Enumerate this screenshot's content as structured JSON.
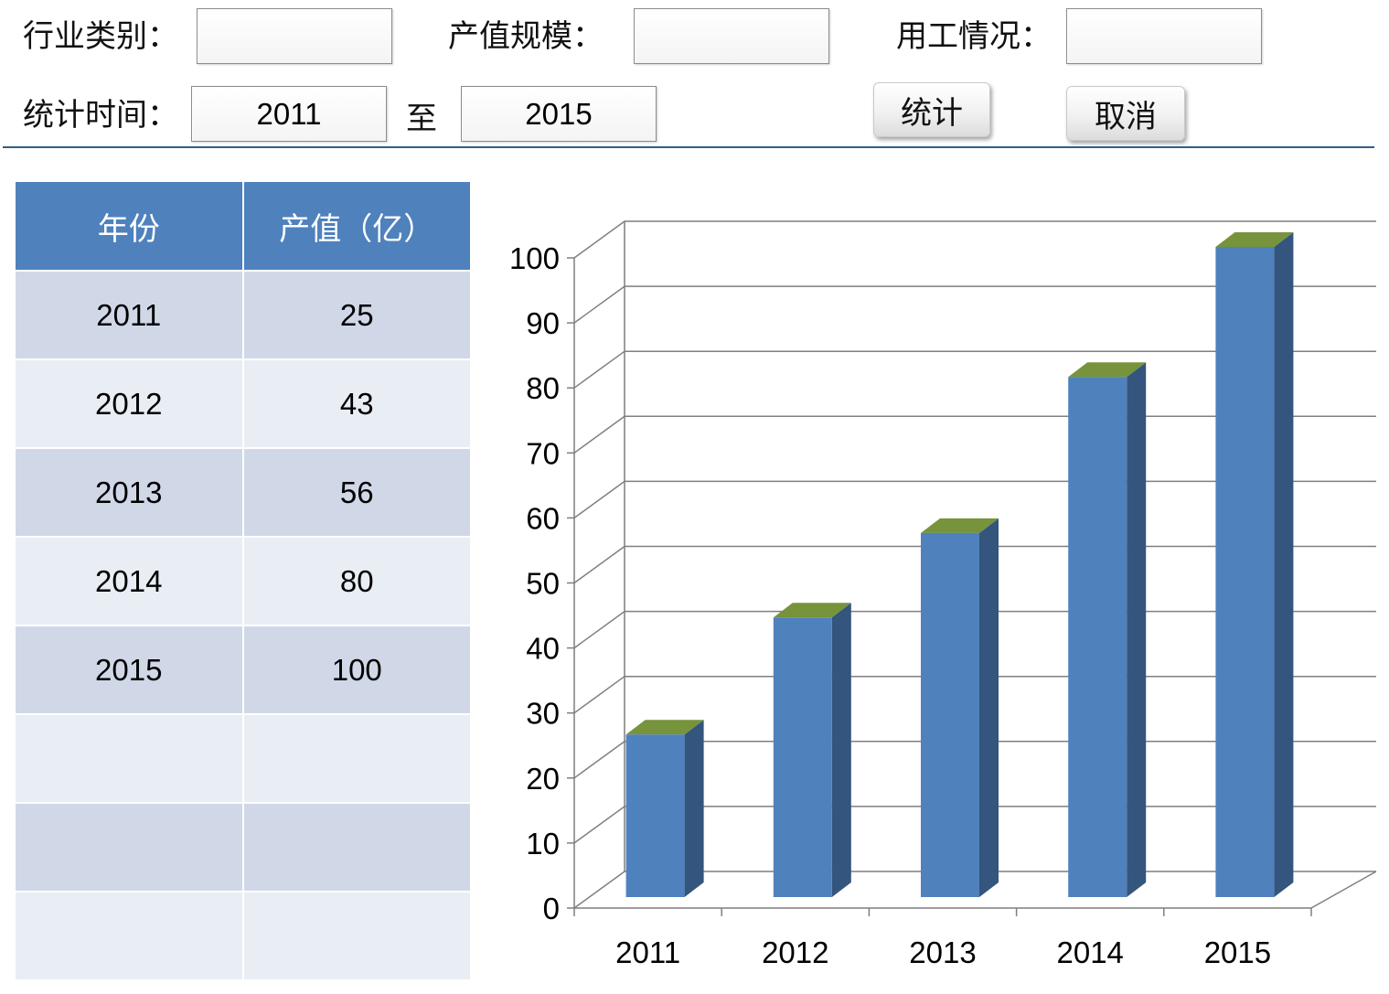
{
  "filters": {
    "industry_label": "行业类别：",
    "industry_value": "",
    "scale_label": "产值规模：",
    "scale_value": "",
    "employment_label": "用工情况：",
    "employment_value": "",
    "period_label": "统计时间：",
    "period_start": "2011",
    "period_to": "至",
    "period_end": "2015"
  },
  "buttons": {
    "stats": "统计",
    "cancel": "取消"
  },
  "table": {
    "headers": [
      "年份",
      "产值（亿）"
    ],
    "rows": [
      [
        "2011",
        "25"
      ],
      [
        "2012",
        "43"
      ],
      [
        "2013",
        "56"
      ],
      [
        "2014",
        "80"
      ],
      [
        "2015",
        "100"
      ],
      [
        "",
        ""
      ],
      [
        "",
        ""
      ],
      [
        "",
        ""
      ]
    ]
  },
  "chart_data": {
    "type": "bar",
    "categories": [
      "2011",
      "2012",
      "2013",
      "2014",
      "2015"
    ],
    "values": [
      25,
      43,
      56,
      80,
      100
    ],
    "title": "",
    "xlabel": "",
    "ylabel": "",
    "ylim": [
      0,
      100
    ],
    "yticks": [
      0,
      10,
      20,
      30,
      40,
      50,
      60,
      70,
      80,
      90,
      100
    ],
    "grid": true,
    "legend": "none",
    "style": "3d-column",
    "colors": {
      "bar_front": "#4f81bd",
      "bar_side": "#34557d",
      "bar_top": "#77933c",
      "grid": "#7f7f7f"
    }
  }
}
